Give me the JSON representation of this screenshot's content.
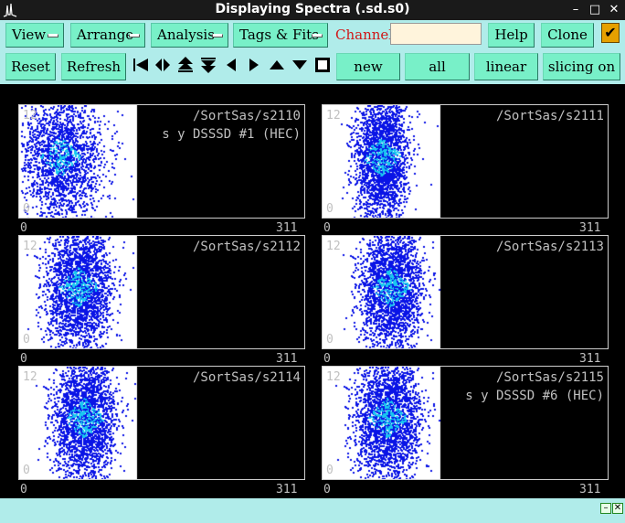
{
  "window": {
    "title": "Displaying Spectra (.sd.s0)",
    "minimize_glyph": "–",
    "maximize_glyph": "□",
    "close_glyph": "✕"
  },
  "menus": [
    {
      "label": "View"
    },
    {
      "label": "Arrange"
    },
    {
      "label": "Analysis"
    },
    {
      "label": "Tags & Fits"
    }
  ],
  "channel": {
    "label": "Channel:",
    "value": ""
  },
  "buttons": {
    "help": "Help",
    "clone": "Clone",
    "reset": "Reset",
    "refresh": "Refresh",
    "new": "new",
    "all": "all",
    "linear": "linear",
    "slicing": "slicing on"
  },
  "checkbox": {
    "checked": true,
    "glyph": "✔"
  },
  "nav_icons": [
    "first-icon",
    "split-icon",
    "scroll-up-fast-icon",
    "scroll-down-fast-icon",
    "previous-icon",
    "next-icon",
    "up-icon",
    "down-icon",
    "stop-icon"
  ],
  "colors": {
    "toolbar_bg": "#b0ecea",
    "button_bg": "#78f0c8",
    "channel_label": "#d01818",
    "scatter_dark": "#0a14e6",
    "scatter_light": "#19c8f0"
  },
  "spectra": [
    {
      "name": "/SortSas/s2110",
      "subtitle": "s y DSSSD #1 (HEC)",
      "ymax_label": "12",
      "ymin_label": "0",
      "xmin_label": "0",
      "xmax_label": "311",
      "plot_fraction": 0.41,
      "cx": 0.35,
      "spread": 0.35,
      "density": 0.8
    },
    {
      "name": "/SortSas/s2111",
      "subtitle": "",
      "ymax_label": "12",
      "ymin_label": "0",
      "xmin_label": "0",
      "xmax_label": "311",
      "plot_fraction": 0.41,
      "cx": 0.5,
      "spread": 0.22,
      "density": 1.0
    },
    {
      "name": "/SortSas/s2112",
      "subtitle": "",
      "ymax_label": "12",
      "ymin_label": "0",
      "xmin_label": "0",
      "xmax_label": "311",
      "plot_fraction": 0.41,
      "cx": 0.5,
      "spread": 0.28,
      "density": 1.3
    },
    {
      "name": "/SortSas/s2113",
      "subtitle": "",
      "ymax_label": "12",
      "ymin_label": "0",
      "xmin_label": "0",
      "xmax_label": "311",
      "plot_fraction": 0.41,
      "cx": 0.58,
      "spread": 0.26,
      "density": 1.4
    },
    {
      "name": "/SortSas/s2114",
      "subtitle": "",
      "ymax_label": "12",
      "ymin_label": "0",
      "xmin_label": "0",
      "xmax_label": "311",
      "plot_fraction": 0.41,
      "cx": 0.55,
      "spread": 0.26,
      "density": 1.4
    },
    {
      "name": "/SortSas/s2115",
      "subtitle": "s y DSSSD #6 (HEC)",
      "ymax_label": "12",
      "ymin_label": "0",
      "xmin_label": "0",
      "xmax_label": "311",
      "plot_fraction": 0.41,
      "cx": 0.55,
      "spread": 0.28,
      "density": 1.3
    }
  ],
  "statusbar": {
    "restore_glyph": "–",
    "close_glyph": "✕"
  }
}
